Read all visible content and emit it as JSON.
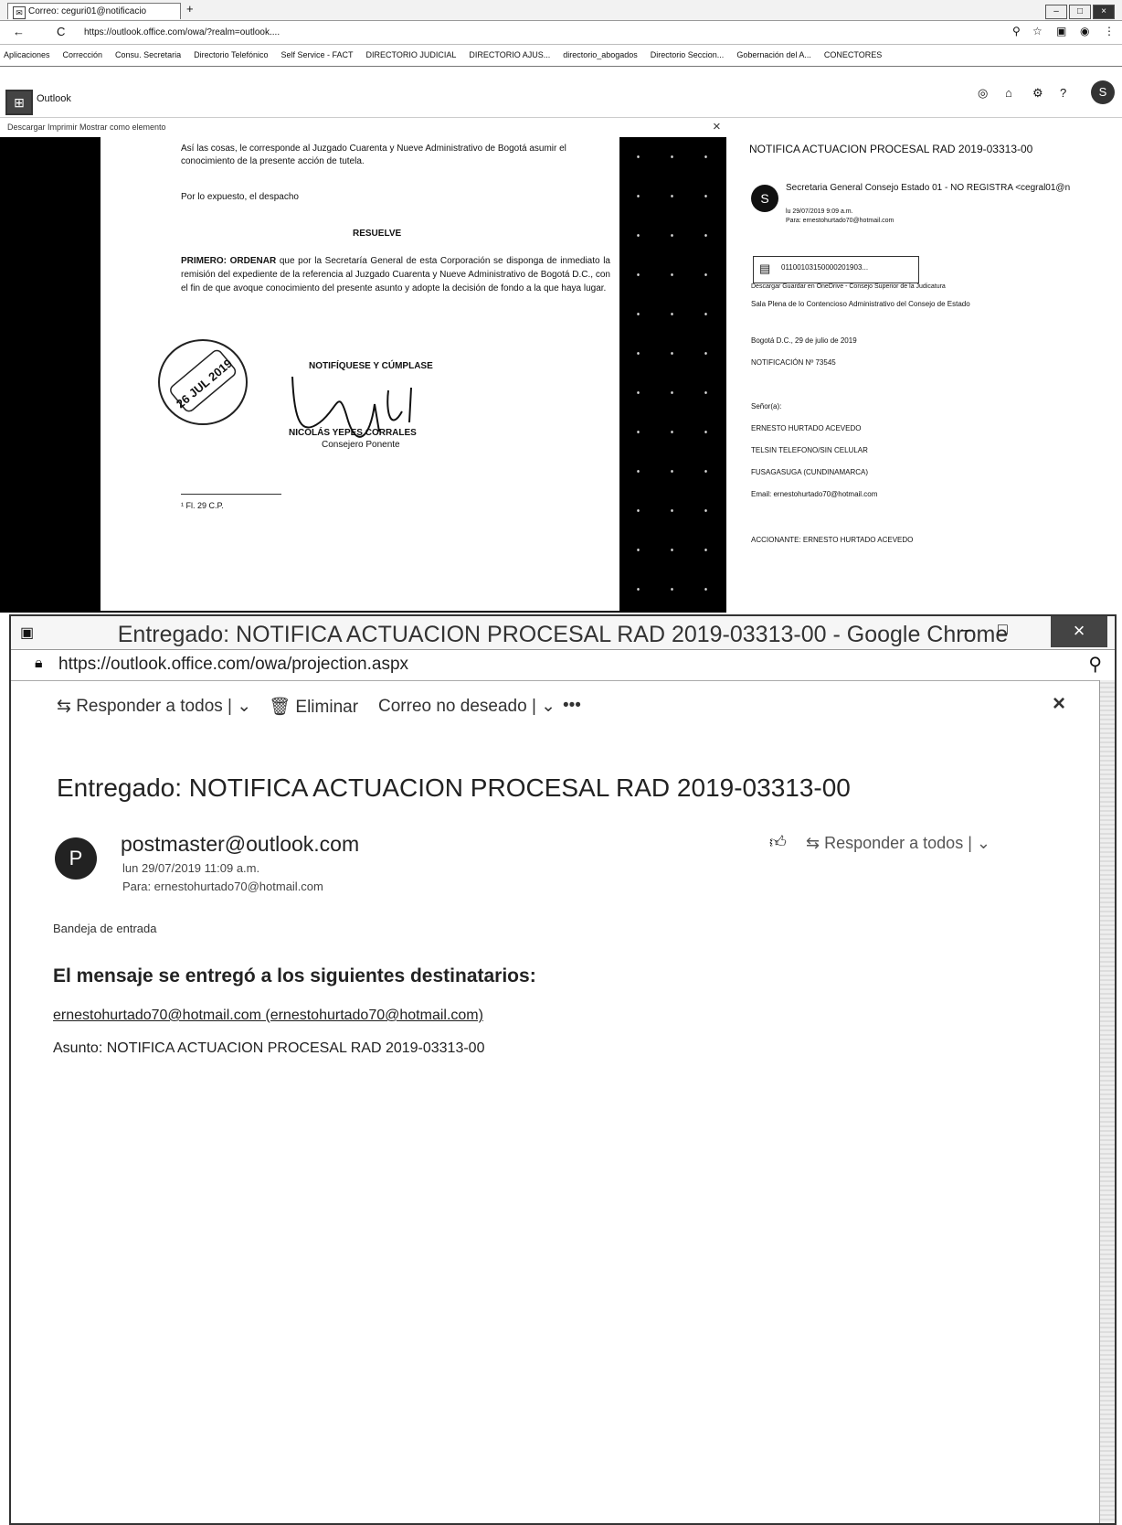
{
  "bg": {
    "tab_title": "Correo: ceguri01@notificacio",
    "new_tab": "+",
    "url": "https://outlook.office.com/owa/?realm=outlook....",
    "bookmarks": [
      "Aplicaciones",
      "Corrección",
      "Consu. Secretaria",
      "Directorio Telefónico",
      "Self Service - FACT",
      "DIRECTORIO JUDICIAL",
      "DIRECTORIO AJUS...",
      "directorio_abogados",
      "Directorio Seccion...",
      "Gobernación del A...",
      "CONECTORES"
    ],
    "app_name": "Outlook",
    "doc_toolbar": "Descargar   Imprimir   Mostrar como elemento",
    "close_x": "×",
    "doc": {
      "p1": "Así las cosas, le corresponde al Juzgado Cuarenta y Nueve Administrativo de Bogotá asumir el conocimiento de la presente acción de tutela.",
      "p2": "Por lo expuesto, el despacho",
      "resuelve": "RESUELVE",
      "primero_bold": "PRIMERO: ORDENAR",
      "primero": " que por la Secretaría General de esta Corporación se disponga de inmediato la remisión del expediente de la referencia al Juzgado Cuarenta y Nueve Administrativo de Bogotá D.C., con el fin de que avoque conocimiento del presente asunto y adopte la decisión de fondo a la que haya lugar.",
      "notif": "NOTIFÍQUESE Y CÚMPLASE",
      "signer": "NICOLÁS YEPES CORRALES",
      "signer_role": "Consejero Ponente",
      "stamp": "26 JUL 2019",
      "footnote": "¹ Fl. 29 C.P."
    },
    "mail": {
      "subject": "NOTIFICA ACTUACION PROCESAL RAD 2019-03313-00",
      "from": "Secretaria General Consejo Estado 01 - NO REGISTRA <cegral01@n",
      "avatar": "S",
      "meta1": "lu 29/07/2019 9:09 a.m.",
      "meta2": "Para: ernestohurtado70@hotmail.com",
      "attach": "01100103150000201903...",
      "attach_actions": "Descargar   Guardar en OneDrive - Consejo Superior de la Judicatura",
      "sala": "Sala Plena de lo Contencioso Administrativo del Consejo de Estado",
      "date": "Bogotá D.C., 29 de julio de 2019",
      "notif_no": "NOTIFICACIÓN Nº 73545",
      "senores": "Señor(a):",
      "name": "ERNESTO HURTADO ACEVEDO",
      "tel": "TELSIN TELEFONO/SIN CELULAR",
      "city": "FUSAGASUGA (CUNDINAMARCA)",
      "email": "Email: ernestohurtado70@hotmail.com",
      "accionante": "ACCIONANTE: ERNESTO HURTADO ACEVEDO"
    }
  },
  "popup": {
    "title": "Entregado: NOTIFICA ACTUACION PROCESAL RAD 2019-03313-00 - Google Chrome",
    "url": "https://outlook.office.com/owa/projection.aspx",
    "cmd_reply_all": "Responder a todos |",
    "cmd_delete": "Eliminar",
    "cmd_junk": "Correo no deseado |",
    "cmd_more": "•••",
    "close": "×",
    "subject": "Entregado: NOTIFICA ACTUACION PROCESAL RAD 2019-03313-00",
    "avatar": "P",
    "sender": "postmaster@outlook.com",
    "date": "lun 29/07/2019 11:09 a.m.",
    "to": "Para: ernestohurtado70@hotmail.com",
    "reply_all": "Responder a todos |",
    "folder": "Bandeja de entrada",
    "heading": "El mensaje se entregó a los siguientes destinatarios:",
    "recipient": "ernestohurtado70@hotmail.com (ernestohurtado70@hotmail.com)",
    "asunto": "Asunto: NOTIFICA ACTUACION PROCESAL RAD 2019-03313-00"
  }
}
